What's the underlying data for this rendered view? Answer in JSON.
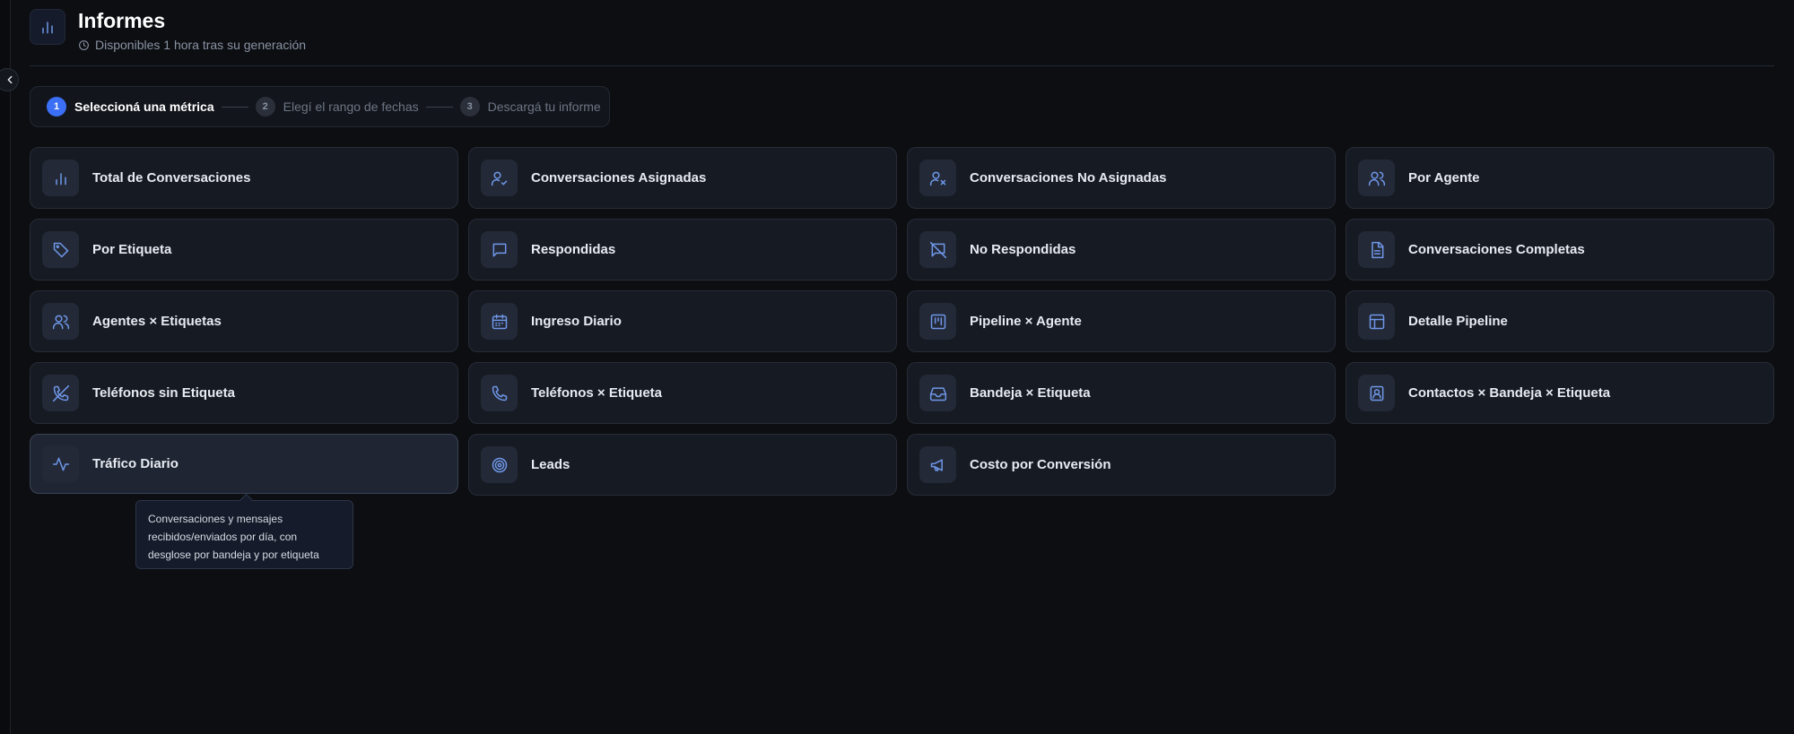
{
  "header": {
    "title": "Informes",
    "subtitle": "Disponibles 1 hora tras su generación"
  },
  "stepper": {
    "steps": [
      {
        "number": "1",
        "label": "Seleccioná una métrica",
        "state": "active"
      },
      {
        "number": "2",
        "label": "Elegí el rango de fechas",
        "state": "inactive"
      },
      {
        "number": "3",
        "label": "Descargá tu informe",
        "state": "inactive"
      }
    ]
  },
  "metrics": [
    {
      "label": "Total de Conversaciones",
      "icon": "bar-chart-icon"
    },
    {
      "label": "Conversaciones Asignadas",
      "icon": "user-check-icon"
    },
    {
      "label": "Conversaciones No Asignadas",
      "icon": "user-x-icon"
    },
    {
      "label": "Por Agente",
      "icon": "users-icon"
    },
    {
      "label": "Por Etiqueta",
      "icon": "tag-icon"
    },
    {
      "label": "Respondidas",
      "icon": "message-square-icon"
    },
    {
      "label": "No Respondidas",
      "icon": "message-square-off-icon"
    },
    {
      "label": "Conversaciones Completas",
      "icon": "file-text-icon"
    },
    {
      "label": "Agentes × Etiquetas",
      "icon": "users-icon"
    },
    {
      "label": "Ingreso Diario",
      "icon": "calendar-icon"
    },
    {
      "label": "Pipeline × Agente",
      "icon": "kanban-icon"
    },
    {
      "label": "Detalle Pipeline",
      "icon": "table-layout-icon"
    },
    {
      "label": "Teléfonos sin Etiqueta",
      "icon": "phone-off-icon"
    },
    {
      "label": "Teléfonos × Etiqueta",
      "icon": "phone-icon"
    },
    {
      "label": "Bandeja × Etiqueta",
      "icon": "inbox-icon"
    },
    {
      "label": "Contactos × Bandeja × Etiqueta",
      "icon": "contact-icon"
    },
    {
      "label": "Tráfico Diario",
      "icon": "activity-icon",
      "hovered": true
    },
    {
      "label": "Leads",
      "icon": "target-icon"
    },
    {
      "label": "Costo por Conversión",
      "icon": "megaphone-icon"
    }
  ],
  "tooltip": {
    "text": "Conversaciones y mensajes recibidos/enviados por día, con desglose por bandeja y por etiqueta"
  },
  "colors": {
    "accent": "#3b6ff5",
    "icon": "#6f97e8",
    "background": "#0c0e12",
    "card": "#161a22"
  }
}
